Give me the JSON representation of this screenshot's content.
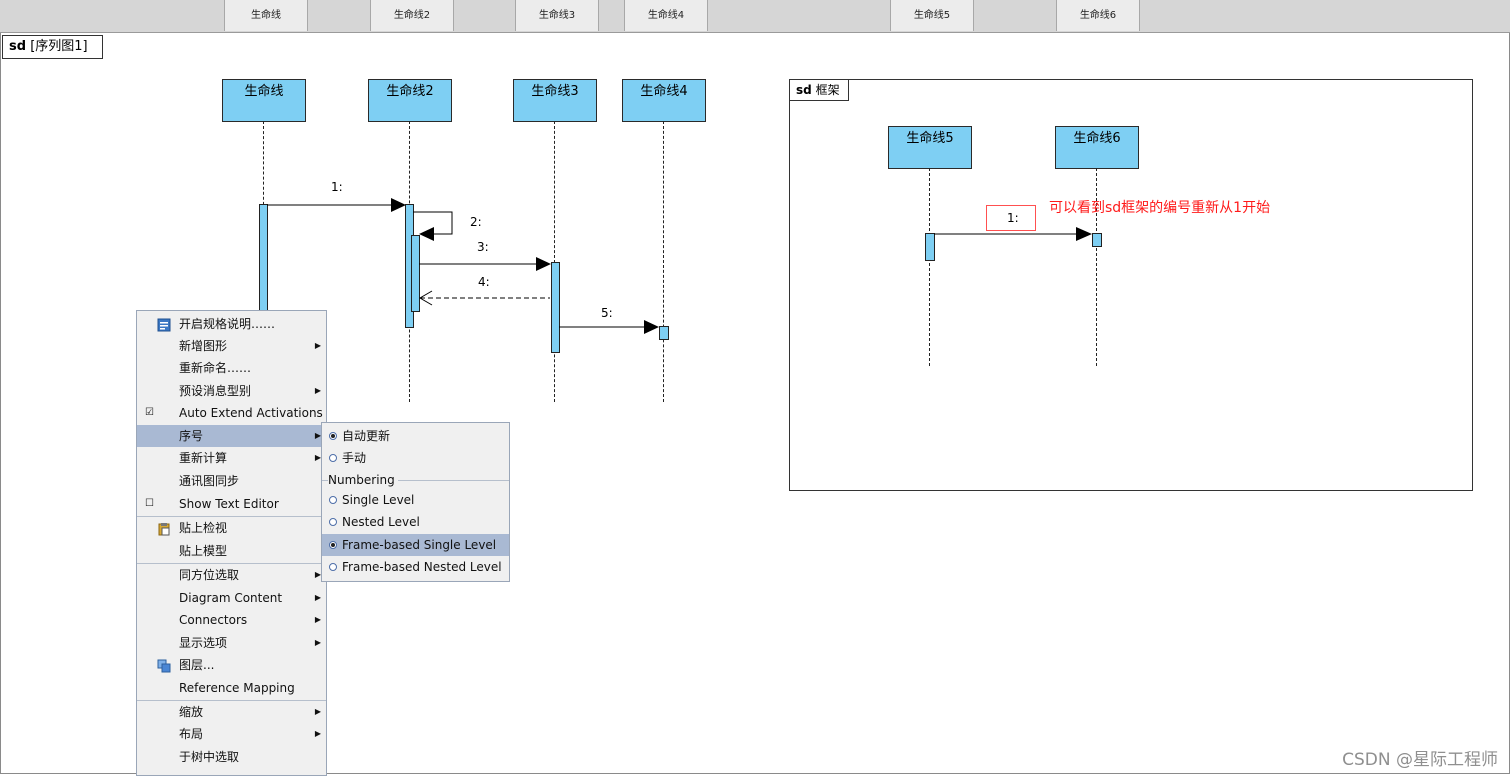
{
  "header": {
    "tabs": [
      "生命线",
      "生命线2",
      "生命线3",
      "生命线4",
      "生命线5",
      "生命线6"
    ]
  },
  "diagram": {
    "kind": "sd",
    "name": "[序列图1]"
  },
  "lifelines": [
    "生命线",
    "生命线2",
    "生命线3",
    "生命线4"
  ],
  "messages": [
    "1:",
    "2:",
    "3:",
    "4:",
    "5:"
  ],
  "frame": {
    "kind": "sd",
    "name": "框架",
    "lifelines": [
      "生命线5",
      "生命线6"
    ],
    "message": "1:",
    "note": "可以看到sd框架的编号重新从1开始",
    "note_color": "#ff1a1a"
  },
  "context_menu": {
    "items": [
      "开启规格说明……",
      "新增图形",
      "重新命名……",
      "预设消息型别",
      "Auto Extend Activations",
      "序号",
      "重新计算",
      "通讯图同步",
      "Show Text Editor",
      "贴上检视",
      "贴上模型",
      "同方位选取",
      "Diagram Content",
      "Connectors",
      "显示选项",
      "图层...",
      "Reference Mapping",
      "缩放",
      "布局",
      "于树中选取"
    ],
    "highlighted": "序号"
  },
  "submenu": {
    "auto_update": "自动更新",
    "manual": "手动",
    "group_label": "Numbering",
    "single_level": "Single Level",
    "nested_level": "Nested Level",
    "frame_single": "Frame-based Single Level",
    "frame_nested": "Frame-based Nested Level",
    "selected": [
      "自动更新",
      "Frame-based Single Level"
    ]
  },
  "colors": {
    "lifeline_fill": "#7ecff3",
    "menu_highlight": "#a9b9d3"
  },
  "watermark": "CSDN @星际工程师"
}
